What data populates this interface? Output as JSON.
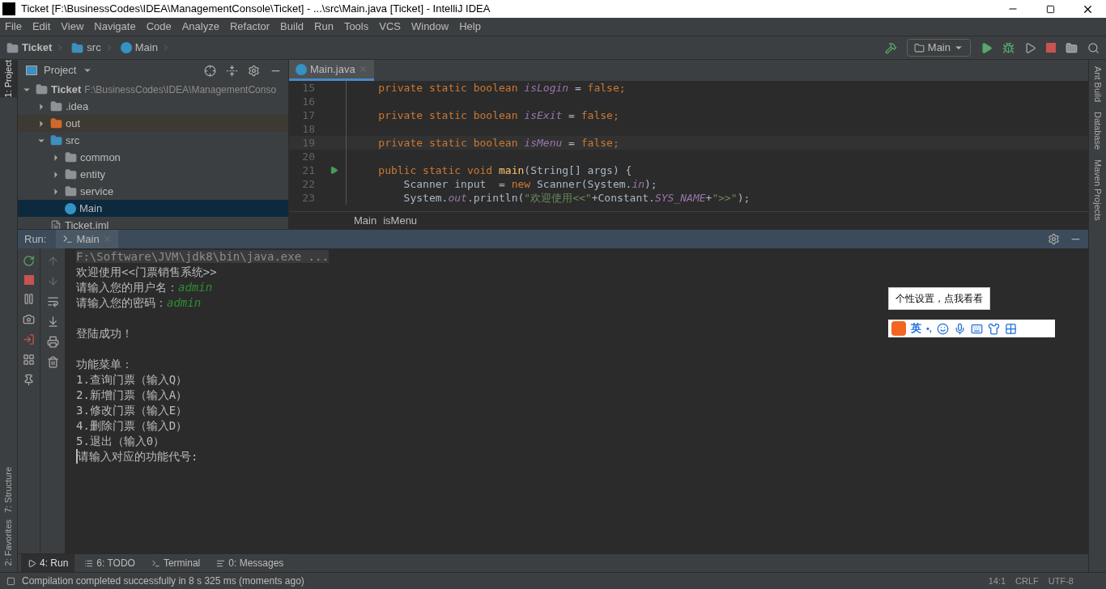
{
  "window": {
    "title": "Ticket [F:\\BusinessCodes\\IDEA\\ManagementConsole\\Ticket] - ...\\src\\Main.java [Ticket] - IntelliJ IDEA"
  },
  "menu": [
    "File",
    "Edit",
    "View",
    "Navigate",
    "Code",
    "Analyze",
    "Refactor",
    "Build",
    "Run",
    "Tools",
    "VCS",
    "Window",
    "Help"
  ],
  "breadcrumbs": [
    {
      "label": "Ticket",
      "kind": "project"
    },
    {
      "label": "src",
      "kind": "folder"
    },
    {
      "label": "Main",
      "kind": "class"
    }
  ],
  "run_config": "Main",
  "left_tabs": [
    {
      "label": "1: Project",
      "selected": true
    },
    {
      "label": "7: Structure",
      "selected": false
    },
    {
      "label": "2: Favorites",
      "selected": false
    }
  ],
  "right_tabs": [
    "Ant Build",
    "Database",
    "Maven Projects"
  ],
  "project": {
    "title": "Project",
    "tree": [
      {
        "label": "Ticket",
        "path": "F:\\BusinessCodes\\IDEA\\ManagementConso",
        "kind": "project",
        "expanded": true,
        "selected": false,
        "children": [
          {
            "label": ".idea",
            "kind": "folder",
            "expanded": false,
            "selected": false
          },
          {
            "label": "out",
            "kind": "excluded",
            "expanded": false,
            "selected": false
          },
          {
            "label": "src",
            "kind": "source",
            "expanded": true,
            "selected": false,
            "children": [
              {
                "label": "common",
                "kind": "package",
                "expanded": false,
                "selected": false
              },
              {
                "label": "entity",
                "kind": "package",
                "expanded": false,
                "selected": false
              },
              {
                "label": "service",
                "kind": "package",
                "expanded": false,
                "selected": false
              },
              {
                "label": "Main",
                "kind": "class",
                "selected": true
              }
            ]
          },
          {
            "label": "Ticket.iml",
            "kind": "file",
            "selected": false
          }
        ]
      }
    ]
  },
  "editor": {
    "tab": "Main.java",
    "lines": [
      {
        "number": "15",
        "segments": [
          {
            "kind": "keyword",
            "text": "    private static boolean "
          },
          {
            "kind": "field",
            "text": "isLogin"
          },
          {
            "kind": "plain",
            "text": " = "
          },
          {
            "kind": "keyword",
            "text": "false;"
          }
        ]
      },
      {
        "number": "16"
      },
      {
        "number": "17",
        "segments": [
          {
            "kind": "keyword",
            "text": "    private static boolean "
          },
          {
            "kind": "field",
            "text": "isExit"
          },
          {
            "kind": "plain",
            "text": " = "
          },
          {
            "kind": "keyword",
            "text": "false;"
          }
        ]
      },
      {
        "number": "18"
      },
      {
        "number": "19",
        "current": true,
        "segments": [
          {
            "kind": "keyword",
            "text": "    private static boolean "
          },
          {
            "kind": "field",
            "text": "isMenu"
          },
          {
            "kind": "plain",
            "text": " = "
          },
          {
            "kind": "keyword",
            "text": "false;"
          }
        ]
      },
      {
        "number": "20"
      },
      {
        "number": "21",
        "run": true,
        "segments": [
          {
            "kind": "keyword",
            "text": "    public static void "
          },
          {
            "kind": "method",
            "text": "main"
          },
          {
            "kind": "plain",
            "text": "(String[] args) {"
          }
        ]
      },
      {
        "number": "22",
        "segments": [
          {
            "kind": "plain",
            "text": "        Scanner input  = "
          },
          {
            "kind": "keyword",
            "text": "new "
          },
          {
            "kind": "plain",
            "text": "Scanner(System."
          },
          {
            "kind": "field",
            "text": "in"
          },
          {
            "kind": "plain",
            "text": ");"
          }
        ]
      },
      {
        "number": "23",
        "segments": [
          {
            "kind": "plain",
            "text": "        System."
          },
          {
            "kind": "field",
            "text": "out"
          },
          {
            "kind": "plain",
            "text": ".println("
          },
          {
            "kind": "string",
            "text": "\"欢迎使用<<\""
          },
          {
            "kind": "plain",
            "text": "+Constant."
          },
          {
            "kind": "field",
            "text": "SYS_NAME"
          },
          {
            "kind": "plain",
            "text": "+"
          },
          {
            "kind": "string",
            "text": "\">>\""
          },
          {
            "kind": "plain",
            "text": ");"
          }
        ]
      }
    ],
    "crumbs": [
      "Main",
      "isMenu"
    ]
  },
  "run": {
    "label": "Run:",
    "tab": "Main",
    "console": [
      {
        "kind": "command",
        "text": "F:\\Software\\JVM\\jdk8\\bin\\java.exe ..."
      },
      {
        "kind": "output",
        "text": "欢迎使用<<门票销售系统>>"
      },
      {
        "kind": "output",
        "text": "请输入您的用户名：",
        "input": "admin"
      },
      {
        "kind": "output",
        "text": "请输入您的密码：",
        "input": "admin"
      },
      {
        "kind": "blank"
      },
      {
        "kind": "output",
        "text": "登陆成功！"
      },
      {
        "kind": "blank"
      },
      {
        "kind": "output",
        "text": "功能菜单："
      },
      {
        "kind": "output",
        "text": "1.查询门票（输入Q）"
      },
      {
        "kind": "output",
        "text": "2.新增门票（输入A）"
      },
      {
        "kind": "output",
        "text": "3.修改门票（输入E）"
      },
      {
        "kind": "output",
        "text": "4.删除门票（输入D）"
      },
      {
        "kind": "output",
        "text": "5.退出（输入0）"
      },
      {
        "kind": "prompt",
        "text": "请输入对应的功能代号:"
      }
    ]
  },
  "ime": {
    "tooltip": "个性设置，点我看看",
    "mode": "英",
    "punct": "•,"
  },
  "bottom_tabs": [
    {
      "label": "4: Run",
      "selected": true
    },
    {
      "label": "6: TODO",
      "selected": false
    },
    {
      "label": "Terminal",
      "selected": false
    },
    {
      "label": "0: Messages",
      "selected": false
    }
  ],
  "status_bar": {
    "message": "Compilation completed successfully in 8 s 325 ms (moments ago)",
    "position": "14:1",
    "line_separator": "CRLF",
    "encoding": "UTF-8"
  }
}
